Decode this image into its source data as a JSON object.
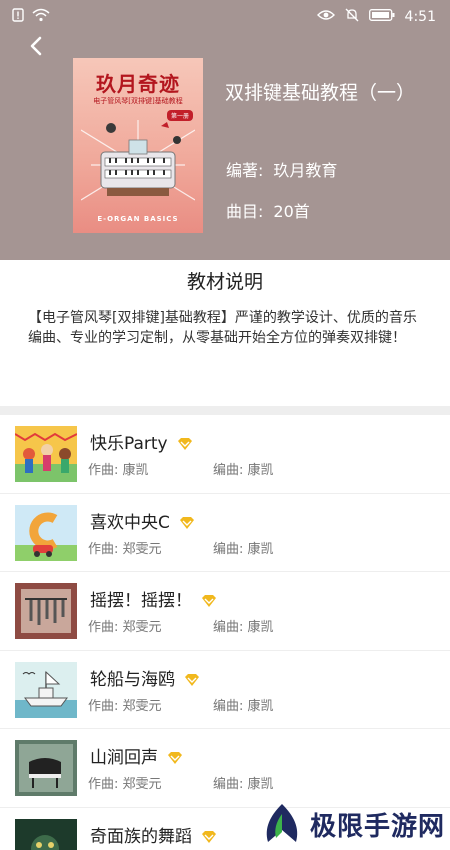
{
  "status_bar": {
    "time": "4:51"
  },
  "book": {
    "cover": {
      "title": "玖月奇迹",
      "subtitle": "电子管风琴[双排键]基础教程",
      "badge": "第一册",
      "english": "E-ORGAN BASICS"
    },
    "title": "双排键基础教程（一）",
    "author_label": "编著:",
    "author": "玖月教育",
    "count_label": "曲目:",
    "count": "20首"
  },
  "description": {
    "heading": "教材说明",
    "text": "【电子管风琴[双排键]基础教程】严谨的教学设计、优质的音乐编曲、专业的学习定制，从零基础开始全方位的弹奏双排键！"
  },
  "songs": [
    {
      "title": "快乐Party",
      "composer": "作曲:  康凯",
      "arranger": "编曲:  康凯",
      "thumb": "party-thumb"
    },
    {
      "title": "喜欢中央C",
      "composer": "作曲:  郑雯元",
      "arranger": "编曲:  康凯",
      "thumb": "letter-c-thumb"
    },
    {
      "title": "摇摆！摇摆！",
      "composer": "作曲:  郑雯元",
      "arranger": "编曲:  康凯",
      "thumb": "chimes-thumb"
    },
    {
      "title": "轮船与海鸥",
      "composer": "作曲:  郑雯元",
      "arranger": "编曲:  康凯",
      "thumb": "ship-thumb"
    },
    {
      "title": "山涧回声",
      "composer": "作曲:  郑雯元",
      "arranger": "编曲:  康凯",
      "thumb": "piano-thumb"
    },
    {
      "title": "奇面族的舞蹈",
      "composer": "",
      "arranger": "",
      "thumb": "masks-thumb"
    }
  ],
  "watermark": {
    "text": "极限手游网"
  },
  "colors": {
    "header_bg": "#a59593",
    "vip_gold": "#f1b81d",
    "cover_red": "#b3161e"
  }
}
